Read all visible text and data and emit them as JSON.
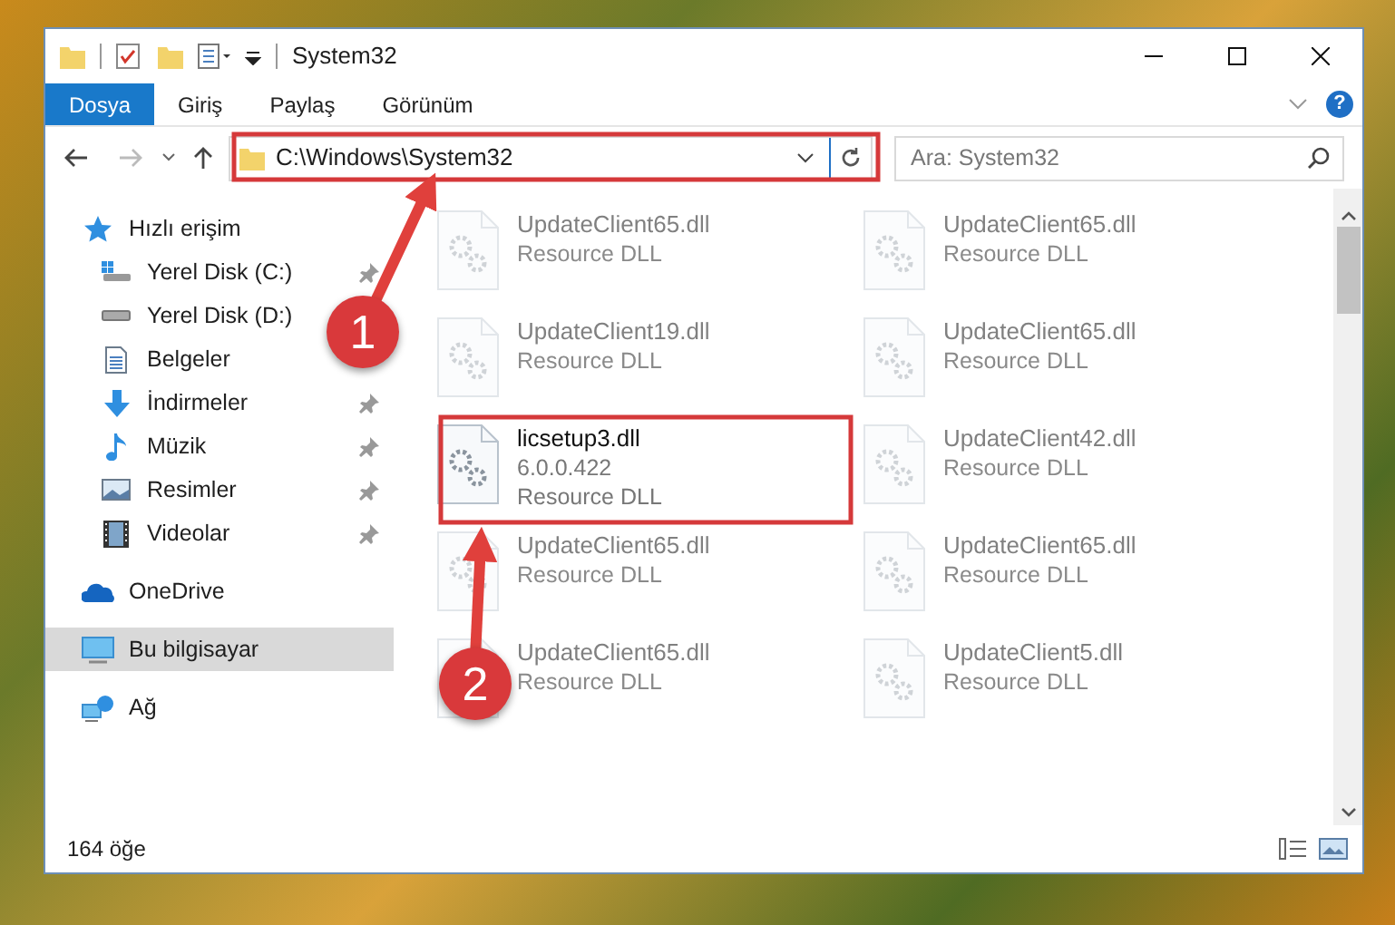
{
  "window": {
    "title": "System32"
  },
  "ribbon_tabs": [
    {
      "label": "Dosya",
      "selected": true
    },
    {
      "label": "Giriş",
      "selected": false
    },
    {
      "label": "Paylaş",
      "selected": false
    },
    {
      "label": "Görünüm",
      "selected": false
    }
  ],
  "help_button": "?",
  "address_bar": {
    "path": "C:\\Windows\\System32"
  },
  "search": {
    "placeholder": "Ara: System32"
  },
  "sidebar": {
    "items": [
      {
        "label": "Hızlı erişim",
        "selected": false,
        "children": [
          {
            "label": "Yerel Disk (C:)",
            "pinned": true
          },
          {
            "label": "Yerel Disk (D:)"
          },
          {
            "label": "Belgeler"
          },
          {
            "label": "İndirmeler",
            "pinned": true
          },
          {
            "label": "Müzik",
            "pinned": true
          },
          {
            "label": "Resimler",
            "pinned": true
          },
          {
            "label": "Videolar",
            "pinned": true
          }
        ]
      },
      {
        "label": "OneDrive",
        "selected": false
      },
      {
        "label": "Bu bilgisayar",
        "selected": true
      },
      {
        "label": "Ağ",
        "selected": false
      }
    ]
  },
  "files": [
    {
      "name": "UpdateClient65.dll",
      "type": "Resource DLL",
      "blurred": true
    },
    {
      "name": "UpdateClient65.dll",
      "type": "Resource DLL",
      "blurred": true
    },
    {
      "name": "UpdateClient19.dll",
      "type": "Resource DLL",
      "blurred": true
    },
    {
      "name": "UpdateClient65.dll",
      "type": "Resource DLL",
      "blurred": true
    },
    {
      "name": "licsetup3.dll",
      "version": "6.0.0.422",
      "type": "Resource DLL",
      "blurred": false
    },
    {
      "name": "UpdateClient42.dll",
      "type": "Resource DLL",
      "blurred": true
    },
    {
      "name": "UpdateClient65.dll",
      "type": "Resource DLL",
      "blurred": true
    },
    {
      "name": "UpdateClient65.dll",
      "type": "Resource DLL",
      "blurred": true
    },
    {
      "name": "UpdateClient65.dll",
      "type": "Resource DLL",
      "blurred": true
    },
    {
      "name": "UpdateClient5.dll",
      "type": "Resource DLL",
      "blurred": true
    }
  ],
  "status_bar": {
    "item_count": "164 öğe"
  },
  "annotations": [
    {
      "label": "1"
    },
    {
      "label": "2"
    }
  ]
}
